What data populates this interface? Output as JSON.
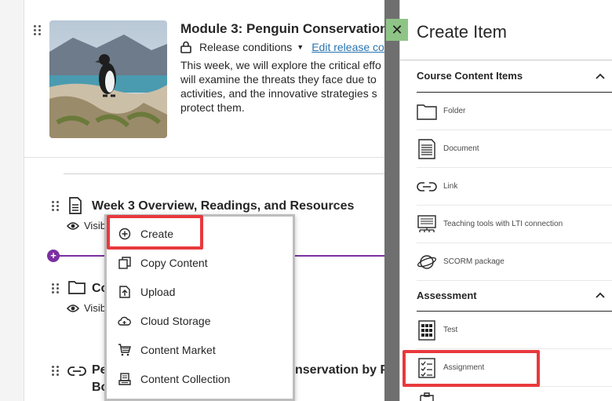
{
  "module": {
    "title": "Module 3: Penguin Conservation",
    "release_label": "Release conditions",
    "edit_release_label": "Edit release co",
    "description": [
      "This week, we will explore the critical effo",
      "will examine the threats they face due to",
      "activities, and the innovative strategies s",
      "protect them."
    ]
  },
  "items": [
    {
      "title": "Week 3 Overview, Readings, and Resources",
      "visibility": "Visib"
    },
    {
      "title": "Co",
      "visibility": "Visib"
    },
    {
      "title_line1": "Pe",
      "title_line1_tail": "nservation by P",
      "title_line2": "Bo"
    }
  ],
  "add_menu": {
    "items": [
      {
        "label": "Create",
        "icon": "plus-circle-icon"
      },
      {
        "label": "Copy Content",
        "icon": "copy-icon"
      },
      {
        "label": "Upload",
        "icon": "upload-icon"
      },
      {
        "label": "Cloud Storage",
        "icon": "cloud-icon"
      },
      {
        "label": "Content Market",
        "icon": "cart-icon"
      },
      {
        "label": "Content Collection",
        "icon": "collection-icon"
      }
    ]
  },
  "panel": {
    "close_label": "✕",
    "title": "Create Item",
    "sections": [
      {
        "label": "Course Content Items",
        "items": [
          {
            "label": "Folder",
            "icon": "folder-icon"
          },
          {
            "label": "Document",
            "icon": "document-icon"
          },
          {
            "label": "Link",
            "icon": "link-icon"
          },
          {
            "label": "Teaching tools with LTI connection",
            "icon": "lti-icon"
          },
          {
            "label": "SCORM package",
            "icon": "scorm-icon"
          }
        ]
      },
      {
        "label": "Assessment",
        "items": [
          {
            "label": "Test",
            "icon": "test-icon"
          },
          {
            "label": "Assignment",
            "icon": "assignment-icon"
          }
        ]
      }
    ]
  },
  "colors": {
    "accent_purple": "#7b2fa1",
    "highlight_red": "#e8393d",
    "close_green": "#8fc487",
    "link_blue": "#2874b0"
  }
}
